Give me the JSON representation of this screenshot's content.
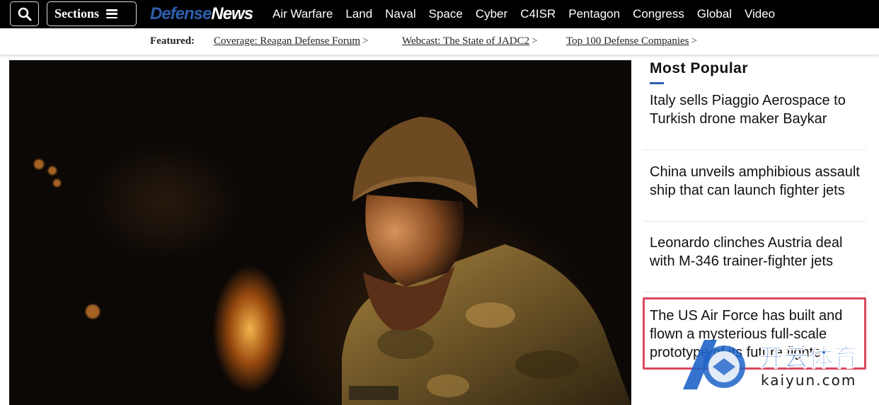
{
  "topbar": {
    "sections_label": "Sections",
    "logo": {
      "part1": "Defense",
      "part2": "News"
    },
    "nav": [
      "Air Warfare",
      "Land",
      "Naval",
      "Space",
      "Cyber",
      "C4ISR",
      "Pentagon",
      "Congress",
      "Global",
      "Video"
    ]
  },
  "featured": {
    "label": "Featured:",
    "links": [
      {
        "text": "Coverage: Reagan Defense Forum",
        "arrow": ">"
      },
      {
        "text": "Webcast: The State of JADC2",
        "arrow": ">"
      },
      {
        "text": "Top 100 Defense Companies",
        "arrow": ">"
      }
    ]
  },
  "popular": {
    "heading": "Most Popular",
    "items": [
      {
        "title": "Italy sells Piaggio Aerospace to Turkish drone maker Baykar"
      },
      {
        "title": "China unveils amphibious assault ship that can launch fighter jets"
      },
      {
        "title": "Leonardo clinches Austria deal with M-346 trainer-fighter jets"
      },
      {
        "title": "The US Air Force has built and flown a mysterious full-scale prototype of its future fighter"
      }
    ]
  },
  "watermark": {
    "text": "开云体育",
    "sub": "kaiyun.com"
  },
  "colors": {
    "brand_blue": "#2f5fae",
    "highlight_border": "#d9485f",
    "topbar_bg": "#000000"
  },
  "icons": {
    "search": "search-icon",
    "menu": "hamburger-menu-icon"
  }
}
